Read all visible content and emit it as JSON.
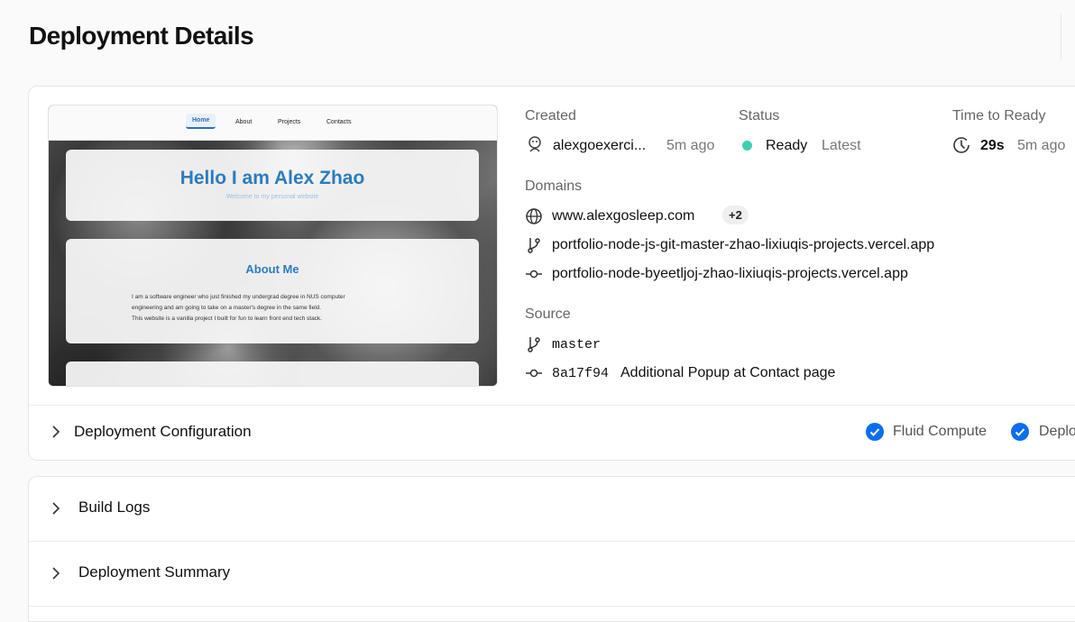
{
  "page": {
    "title": "Deployment Details"
  },
  "preview": {
    "nav": [
      "Home",
      "About",
      "Projects",
      "Contacts"
    ],
    "hero_title": "Hello I am Alex Zhao",
    "hero_subtitle": "Welcome to my personal website",
    "about_title": "About Me",
    "about_line1": "I am a software engineer who just finished my undergrad degree in NUS computer",
    "about_line2": "engineering and am going to take on a master's degree in the same field.",
    "about_line3": "This website is a vanilla project I built for fun to learn front end tech stack."
  },
  "created": {
    "label": "Created",
    "user": "alexgoexerci...",
    "ago": "5m ago"
  },
  "status": {
    "label": "Status",
    "value": "Ready",
    "tag": "Latest",
    "color": "#3fd0b0"
  },
  "ready": {
    "label": "Time to Ready",
    "duration": "29s",
    "ago": "5m ago"
  },
  "domains": {
    "label": "Domains",
    "primary": "www.alexgosleep.com",
    "more": "+2",
    "branch_domain": "portfolio-node-js-git-master-zhao-lixiuqis-projects.vercel.app",
    "commit_domain": "portfolio-node-byeetljoj-zhao-lixiuqis-projects.vercel.app"
  },
  "source": {
    "label": "Source",
    "branch": "master",
    "commit_hash": "8a17f94",
    "commit_message": "Additional Popup at Contact page"
  },
  "config": {
    "label": "Deployment Configuration",
    "features": [
      "Fluid Compute",
      "Deplo"
    ],
    "check_color": "#0a6ef0"
  },
  "sections": {
    "build_logs": "Build Logs",
    "summary": "Deployment Summary"
  }
}
